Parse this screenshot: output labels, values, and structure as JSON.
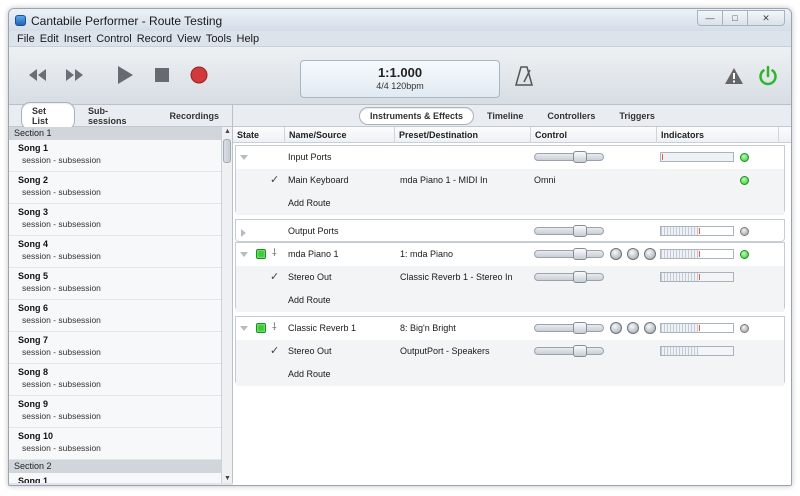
{
  "window": {
    "title": "Cantabile Performer - Route Testing",
    "min": "—",
    "max": "□",
    "close": "✕"
  },
  "menu": [
    "File",
    "Edit",
    "Insert",
    "Control",
    "Record",
    "View",
    "Tools",
    "Help"
  ],
  "transport": {
    "position": "1:1.000",
    "tempo": "4/4 120bpm"
  },
  "left_tabs": [
    "Set List",
    "Sub-sessions",
    "Recordings"
  ],
  "right_tabs": [
    "Instruments & Effects",
    "Timeline",
    "Controllers",
    "Triggers"
  ],
  "setlist": {
    "section1": "Section 1",
    "songs": [
      {
        "name": "Song 1",
        "sub": "session - subsession"
      },
      {
        "name": "Song 2",
        "sub": "session - subsession"
      },
      {
        "name": "Song 3",
        "sub": "session - subsession"
      },
      {
        "name": "Song 4",
        "sub": "session - subsession"
      },
      {
        "name": "Song 5",
        "sub": "session - subsession"
      },
      {
        "name": "Song 6",
        "sub": "session - subsession"
      },
      {
        "name": "Song 7",
        "sub": "session - subsession"
      },
      {
        "name": "Song 8",
        "sub": "session - subsession"
      },
      {
        "name": "Song 9",
        "sub": "session - subsession"
      },
      {
        "name": "Song 10",
        "sub": "session - subsession"
      }
    ],
    "section2": "Section 2",
    "partial_song": "Song 1"
  },
  "columns": [
    "State",
    "Name/Source",
    "Preset/Destination",
    "Control",
    "Indicators"
  ],
  "groups": {
    "input_ports": {
      "name": "Input Ports",
      "route": {
        "name": "Main Keyboard",
        "dest": "mda Piano 1 - MIDI In",
        "control": "Omni"
      },
      "add_route": "Add Route"
    },
    "output_ports": {
      "name": "Output Ports"
    },
    "piano": {
      "name": "mda Piano 1",
      "preset": "1: mda Piano",
      "route": {
        "name": "Stereo Out",
        "dest": "Classic Reverb 1 - Stereo In"
      },
      "add_route": "Add Route"
    },
    "reverb": {
      "name": "Classic Reverb 1",
      "preset": "8: Big'n Bright",
      "route": {
        "name": "Stereo Out",
        "dest": "OutputPort - Speakers"
      },
      "add_route": "Add Route"
    }
  },
  "glyphs": {
    "check": "✓",
    "pin": "⸸",
    "up": "▲",
    "down": "▼"
  }
}
